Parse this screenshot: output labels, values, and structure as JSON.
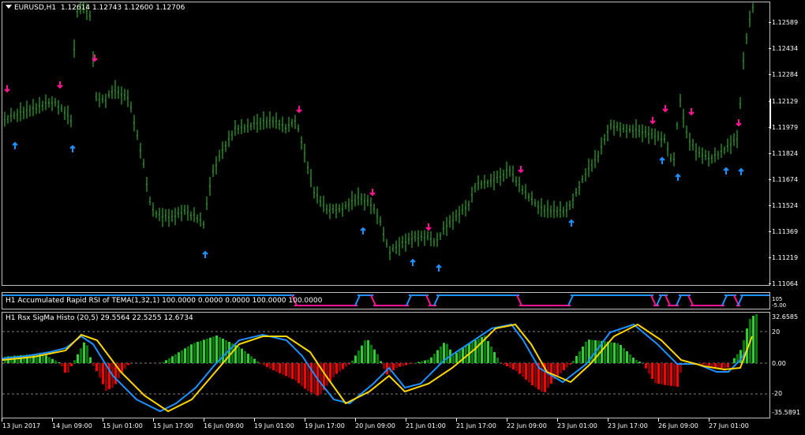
{
  "main": {
    "symbol_title": "EURUSD,H1",
    "ohlc": "1.12614 1.12743 1.12600 1.12706",
    "price_labels": [
      "1.12589",
      "1.12434",
      "1.12284",
      "1.12129",
      "1.11979",
      "1.11824",
      "1.11674",
      "1.11524",
      "1.11369",
      "1.11219",
      "1.11064"
    ]
  },
  "rsi": {
    "title": "H1 Accumulated Rapid RSI of TEMA(1,32,1) 100.0000 0.0000 0.0000 100.0000 100.0000",
    "scale_labels": [
      "105",
      "-5.00"
    ]
  },
  "histo": {
    "title": "H1  Rsx SigMa Histo (20,5) 29.5564 22.5255 12.6734",
    "scale_labels": [
      "32.6585",
      "20",
      "0.00",
      "-20",
      "-35.5891"
    ]
  },
  "time_labels": [
    "13 Jun 2017",
    "14 Jun 09:00",
    "15 Jun 01:00",
    "15 Jun 17:00",
    "16 Jun 09:00",
    "19 Jun 01:00",
    "19 Jun 17:00",
    "20 Jun 09:00",
    "21 Jun 01:00",
    "21 Jun 17:00",
    "22 Jun 09:00",
    "23 Jun 01:00",
    "23 Jun 17:00",
    "26 Jun 09:00",
    "27 Jun 01:00"
  ],
  "colors": {
    "candles": "#32cd32",
    "buy_arrow": "#1e90ff",
    "sell_arrow": "#ff1493",
    "rsi_up": "#1e90ff",
    "rsi_down": "#ff1493",
    "histo_pos": "#32cd32",
    "histo_pos_dark": "#008000",
    "histo_neg": "#ff0000",
    "histo_neg_dark": "#8b0000",
    "blue_line": "#1e90ff",
    "yellow_line": "#ffd700"
  },
  "icons": {
    "buy": "up-arrow",
    "sell": "down-arrow",
    "menu": "dropdown-triangle"
  }
}
